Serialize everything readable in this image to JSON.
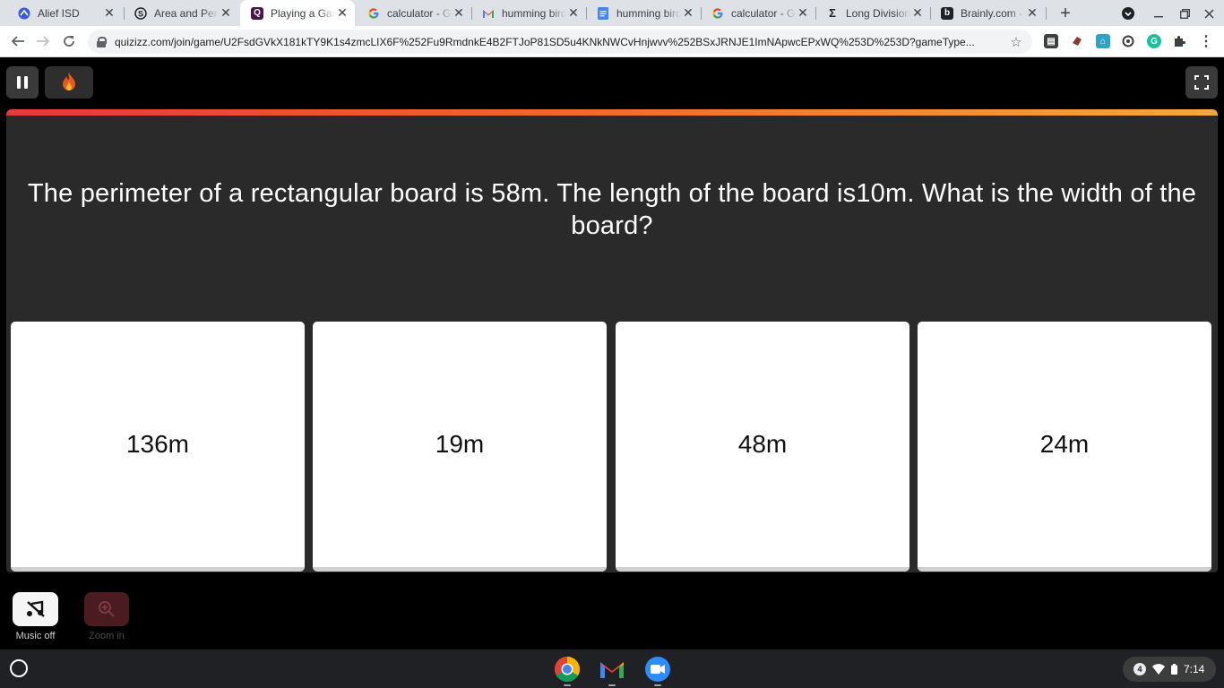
{
  "browser": {
    "tabs": [
      {
        "title": "Alief ISD",
        "icon": "alief-icon",
        "color": "#3b5bdb"
      },
      {
        "title": "Area and Perimeter",
        "icon": "s-logo-icon",
        "color": "#202124"
      },
      {
        "title": "Playing a Game - Quizizz",
        "icon": "quizizz-icon",
        "color": "#4a154b",
        "active": true
      },
      {
        "title": "calculator - Google Search",
        "icon": "google-icon",
        "color": "#4285f4"
      },
      {
        "title": "humming bird - Gmail",
        "icon": "gmail-icon",
        "color": "#ea4335"
      },
      {
        "title": "humming bird - Google Docs",
        "icon": "docs-icon",
        "color": "#4285f4"
      },
      {
        "title": "calculator - Google Search",
        "icon": "google-icon",
        "color": "#4285f4"
      },
      {
        "title": "Long Division Calculator",
        "icon": "sigma-icon",
        "color": "#202124"
      },
      {
        "title": "Brainly.com - For students",
        "icon": "brainly-icon",
        "color": "#202124"
      }
    ],
    "new_tab_label": "+",
    "url": "quizizz.com/join/game/U2FsdGVkX181kTY9K1s4zmcLIX6F%252Fu9RmdnkE4B2FTJoP81SD5u4KNkNWCvHnjwvv%252BSxJRNJE1ImNApwcEPxWQ%253D%253D?gameType..."
  },
  "quiz": {
    "question": "The perimeter of a rectangular board is 58m. The length of the board is10m. What is the width of the board?",
    "options": [
      "136m",
      "19m",
      "48m",
      "24m"
    ],
    "music_label": "Music off",
    "zoom_label": "Zoom in",
    "timer_colors": [
      "#e53935",
      "#f2a93b"
    ]
  },
  "shelf": {
    "notification_count": "4",
    "time": "7:14",
    "apps": [
      "chrome-icon",
      "gmail-icon",
      "zoom-icon"
    ]
  }
}
